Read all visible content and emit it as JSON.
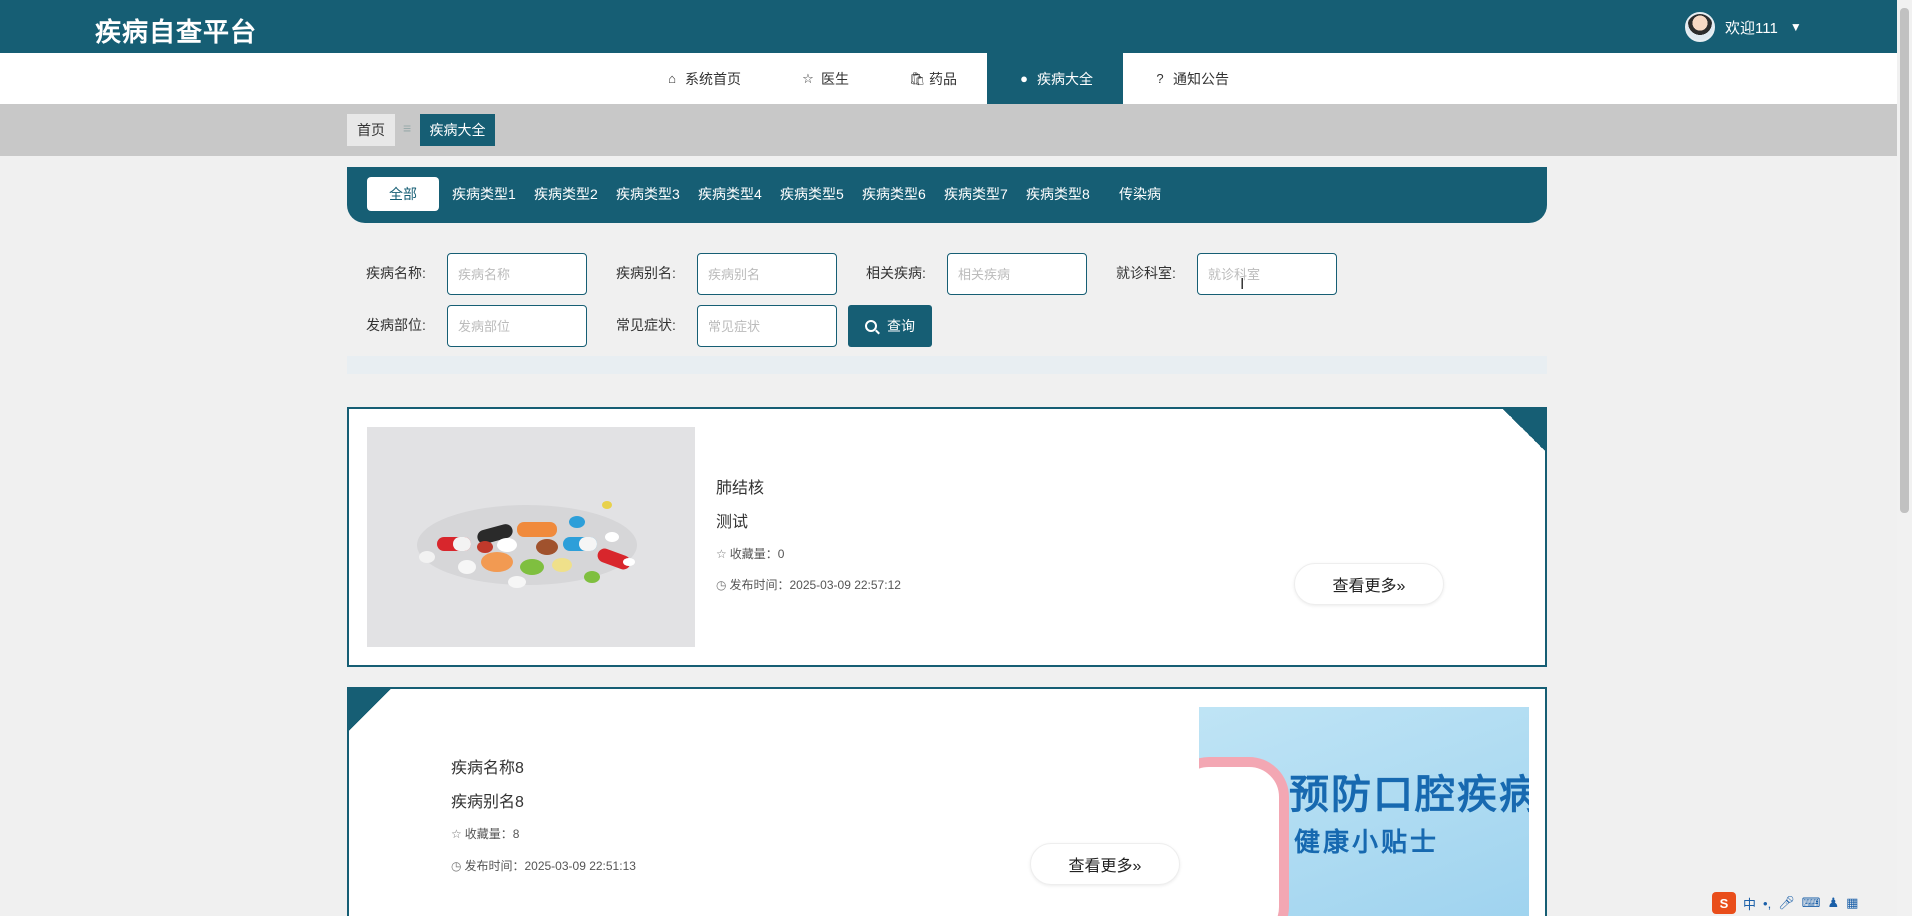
{
  "header": {
    "brand": "疾病自查平台",
    "welcome": "欢迎111"
  },
  "nav": {
    "items": [
      {
        "label": "系统首页",
        "icon": "home-icon",
        "active": false
      },
      {
        "label": "医生",
        "icon": "star-icon",
        "active": false
      },
      {
        "label": "药品",
        "icon": "bag-icon",
        "active": false
      },
      {
        "label": "疾病大全",
        "icon": "info-icon",
        "active": true
      },
      {
        "label": "通知公告",
        "icon": "question-icon",
        "active": false
      }
    ]
  },
  "breadcrumb": {
    "home": "首页",
    "separator": "≡",
    "current": "疾病大全"
  },
  "categories": [
    "全部",
    "疾病类型1",
    "疾病类型2",
    "疾病类型3",
    "疾病类型4",
    "疾病类型5",
    "疾病类型6",
    "疾病类型7",
    "疾病类型8",
    "传染病"
  ],
  "search": {
    "fields": [
      {
        "label": "疾病名称:",
        "placeholder": "疾病名称"
      },
      {
        "label": "疾病别名:",
        "placeholder": "疾病别名"
      },
      {
        "label": "相关疾病:",
        "placeholder": "相关疾病"
      },
      {
        "label": "就诊科室:",
        "placeholder": "就诊科室"
      },
      {
        "label": "发病部位:",
        "placeholder": "发病部位"
      },
      {
        "label": "常见症状:",
        "placeholder": "常见症状"
      }
    ],
    "button": "查询"
  },
  "cards": [
    {
      "title": "肺结核",
      "alias": "测试",
      "favorites_label": "收藏量：0",
      "published_label": "发布时间：2025-03-09 22:57:12",
      "more": "查看更多»"
    },
    {
      "title": "疾病名称8",
      "alias": "疾病别名8",
      "favorites_label": "收藏量：8",
      "published_label": "发布时间：2025-03-09 22:51:13",
      "more": "查看更多»",
      "poster_title": "预防口腔疾病",
      "poster_subtitle": "健康小贴士"
    }
  ],
  "ime": {
    "logo": "S",
    "mode": "中"
  },
  "colors": {
    "primary": "#165e74",
    "background": "#f0f0f0",
    "breadcrumb_strip": "#c8c8c8"
  }
}
